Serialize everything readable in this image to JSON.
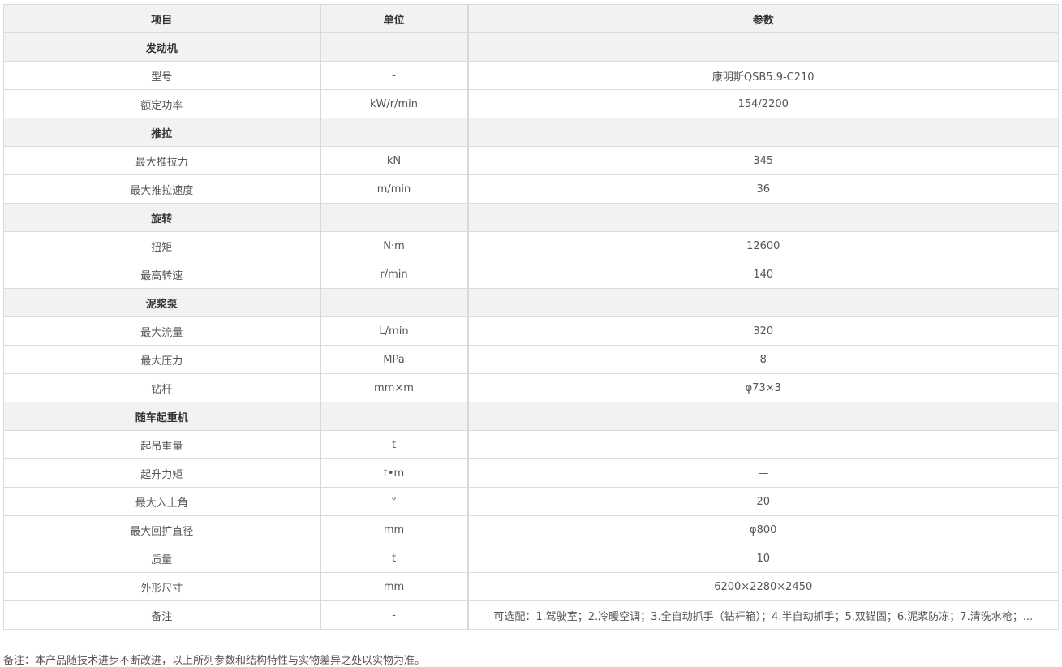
{
  "table": {
    "headers": [
      "项目",
      "单位",
      "参数"
    ],
    "rows": [
      {
        "type": "section",
        "item": "发动机"
      },
      {
        "type": "data",
        "item": "型号",
        "unit": "-",
        "value": "康明斯QSB5.9-C210"
      },
      {
        "type": "data",
        "item": "额定功率",
        "unit": "kW/r/min",
        "value": "154/2200"
      },
      {
        "type": "section",
        "item": "推拉"
      },
      {
        "type": "data",
        "item": "最大推拉力",
        "unit": "kN",
        "value": "345"
      },
      {
        "type": "data",
        "item": "最大推拉速度",
        "unit": "m/min",
        "value": "36"
      },
      {
        "type": "section",
        "item": "旋转"
      },
      {
        "type": "data",
        "item": "扭矩",
        "unit": "N·m",
        "value": "12600"
      },
      {
        "type": "data",
        "item": "最高转速",
        "unit": "r/min",
        "value": "140"
      },
      {
        "type": "section",
        "item": "泥浆泵"
      },
      {
        "type": "data",
        "item": "最大流量",
        "unit": "L/min",
        "value": "320"
      },
      {
        "type": "data",
        "item": "最大压力",
        "unit": "MPa",
        "value": "8"
      },
      {
        "type": "data",
        "item": "钻杆",
        "unit": "mm×m",
        "value": "φ73×3"
      },
      {
        "type": "section",
        "item": "随车起重机"
      },
      {
        "type": "data",
        "item": "起吊重量",
        "unit": "t",
        "value": "—"
      },
      {
        "type": "data",
        "item": "起升力矩",
        "unit": "t•m",
        "value": "—"
      },
      {
        "type": "data",
        "item": "最大入土角",
        "unit": "°",
        "value": "20"
      },
      {
        "type": "data",
        "item": "最大回扩直径",
        "unit": "mm",
        "value": "φ800"
      },
      {
        "type": "data",
        "item": "质量",
        "unit": "t",
        "value": "10"
      },
      {
        "type": "data",
        "item": "外形尺寸",
        "unit": "mm",
        "value": "6200×2280×2450"
      },
      {
        "type": "data",
        "item": "备注",
        "unit": "-",
        "value": "可选配：1.驾驶室；2.冷暖空调；3.全自动抓手（钻杆箱）；4.半自动抓手；5.双锚固；6.泥浆防冻；7.清洗水枪；..."
      }
    ]
  },
  "footnote": "备注：本产品随技术进步不断改进，以上所列参数和结构特性与实物差异之处以实物为准。"
}
